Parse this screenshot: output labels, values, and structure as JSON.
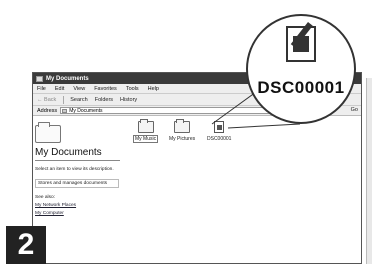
{
  "window": {
    "title": "My Documents",
    "menu": [
      "File",
      "Edit",
      "View",
      "Favorites",
      "Tools",
      "Help"
    ],
    "toolbar": {
      "back": "← Back",
      "search": "Search",
      "folders": "Folders",
      "history": "History"
    },
    "address": {
      "label": "Address",
      "value": "My Documents",
      "go": "Go"
    }
  },
  "leftpane": {
    "title": "My Documents",
    "select_prompt": "Select an item to view its description.",
    "description": "Stores and manages documents",
    "see_also": "See also:",
    "links": [
      "My Network Places",
      "My Computer"
    ]
  },
  "files": [
    {
      "name": "My Music",
      "icon": "folder-icon"
    },
    {
      "name": "My Pictures",
      "icon": "pictures-folder-icon"
    },
    {
      "name": "DSC00001",
      "icon": "image-file-icon"
    }
  ],
  "callout": {
    "label": "DSC00001"
  },
  "step": {
    "number": "2"
  }
}
